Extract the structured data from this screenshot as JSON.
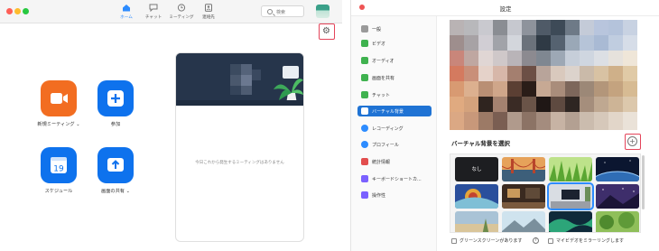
{
  "main_window": {
    "nav": [
      {
        "label": "ホーム",
        "icon": "home-icon",
        "active": true
      },
      {
        "label": "チャット",
        "icon": "chat-icon",
        "active": false
      },
      {
        "label": "ミーティング",
        "icon": "clock-icon",
        "active": false
      },
      {
        "label": "連絡先",
        "icon": "contacts-icon",
        "active": false
      }
    ],
    "search_placeholder": "検索",
    "actions": [
      {
        "label": "新規ミーティング ⌄",
        "icon": "video-camera-icon",
        "color": "#f26d21"
      },
      {
        "label": "参加",
        "icon": "plus-icon",
        "color": "#0e72ed"
      },
      {
        "label": "スケジュール",
        "icon": "calendar-icon",
        "calendar_day": "19",
        "color": "#0e72ed"
      },
      {
        "label": "画面の共有 ⌄",
        "icon": "share-screen-icon",
        "color": "#0e72ed"
      }
    ],
    "upcoming_empty": "今日これから発生するミーティングはありません"
  },
  "settings_window": {
    "title": "設定",
    "sidebar": [
      {
        "label": "一般",
        "icon": "gear-icon",
        "color": "#9a9a9a"
      },
      {
        "label": "ビデオ",
        "icon": "video-icon",
        "color": "#3fb24f"
      },
      {
        "label": "オーディオ",
        "icon": "headphones-icon",
        "color": "#3fb24f"
      },
      {
        "label": "画面を共有",
        "icon": "share-screen-icon",
        "color": "#3fb24f"
      },
      {
        "label": "チャット",
        "icon": "chat-icon",
        "color": "#3fb24f"
      },
      {
        "label": "バーチャル背景",
        "icon": "virtual-background-icon",
        "color": "#ffffff",
        "active": true
      },
      {
        "label": "レコーディング",
        "icon": "record-icon",
        "color": "#2d8cff"
      },
      {
        "label": "プロフィール",
        "icon": "profile-icon",
        "color": "#2d8cff"
      },
      {
        "label": "統計情報",
        "icon": "statistics-icon",
        "color": "#e24e4e"
      },
      {
        "label": "キーボードショートカ...",
        "icon": "keyboard-icon",
        "color": "#7b61ff"
      },
      {
        "label": "操作性",
        "icon": "accessibility-icon",
        "color": "#7b61ff"
      }
    ],
    "virtual_background_heading": "バーチャル背景を選択",
    "none_label": "なし",
    "green_screen_label": "グリーンスクリーンがあります",
    "mirror_label": "マイビデオをミラーリングします",
    "help_icon": "?"
  },
  "colors": {
    "accent_blue": "#2d8cff",
    "highlight_red": "#e4445a"
  }
}
